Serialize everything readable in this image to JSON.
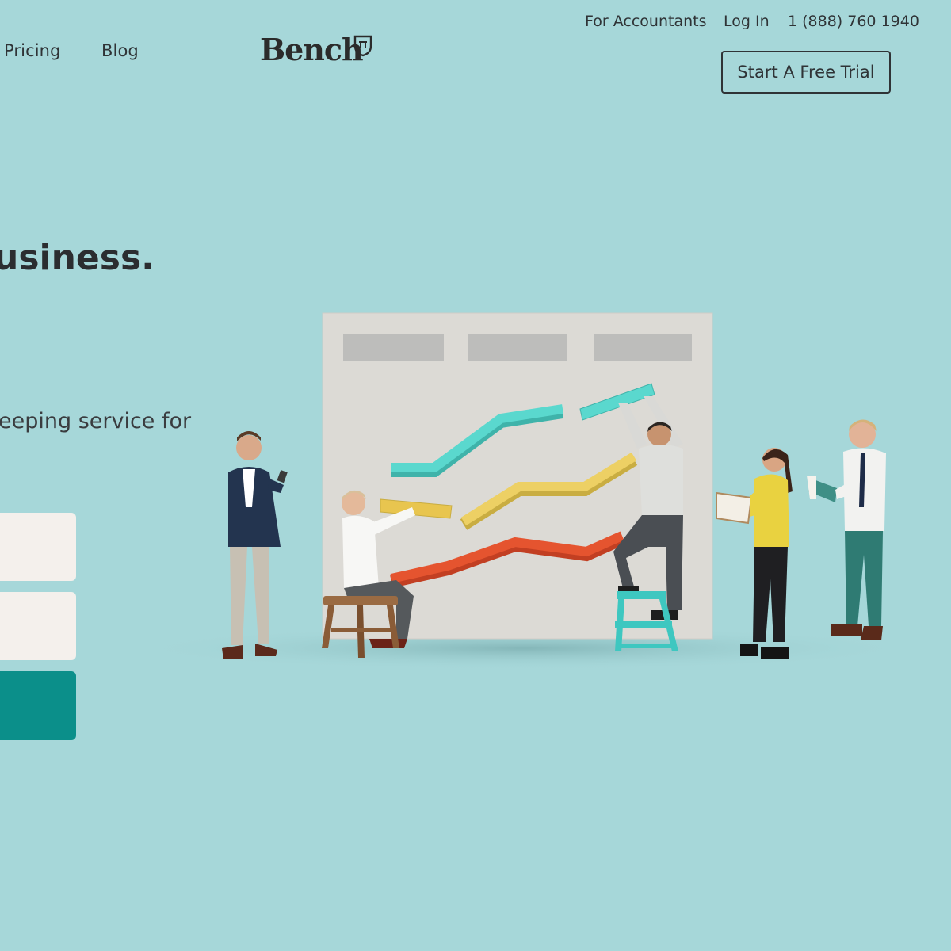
{
  "nav": {
    "pricing": "Pricing",
    "blog": "Blog"
  },
  "brand": {
    "name": "Bench",
    "logo_icon": "bench-shield-icon"
  },
  "top_links": {
    "accountants": "For Accountants",
    "login": "Log In",
    "phone": "1 (888) 760 1940"
  },
  "cta_header": {
    "label": "Start A Free Trial"
  },
  "hero": {
    "headline_fragment": "usiness.",
    "subtext_fragment": "eeping service for"
  },
  "form": {
    "field1_value": "",
    "field2_value": "",
    "submit_label": ""
  },
  "colors": {
    "background": "#a6d7d9",
    "cta": "#0b8f8a",
    "field": "#f4f0ec",
    "line_teal": "#55d6cc",
    "line_yellow": "#ecd063",
    "line_red": "#e5532f",
    "board": "#dcdad5"
  }
}
